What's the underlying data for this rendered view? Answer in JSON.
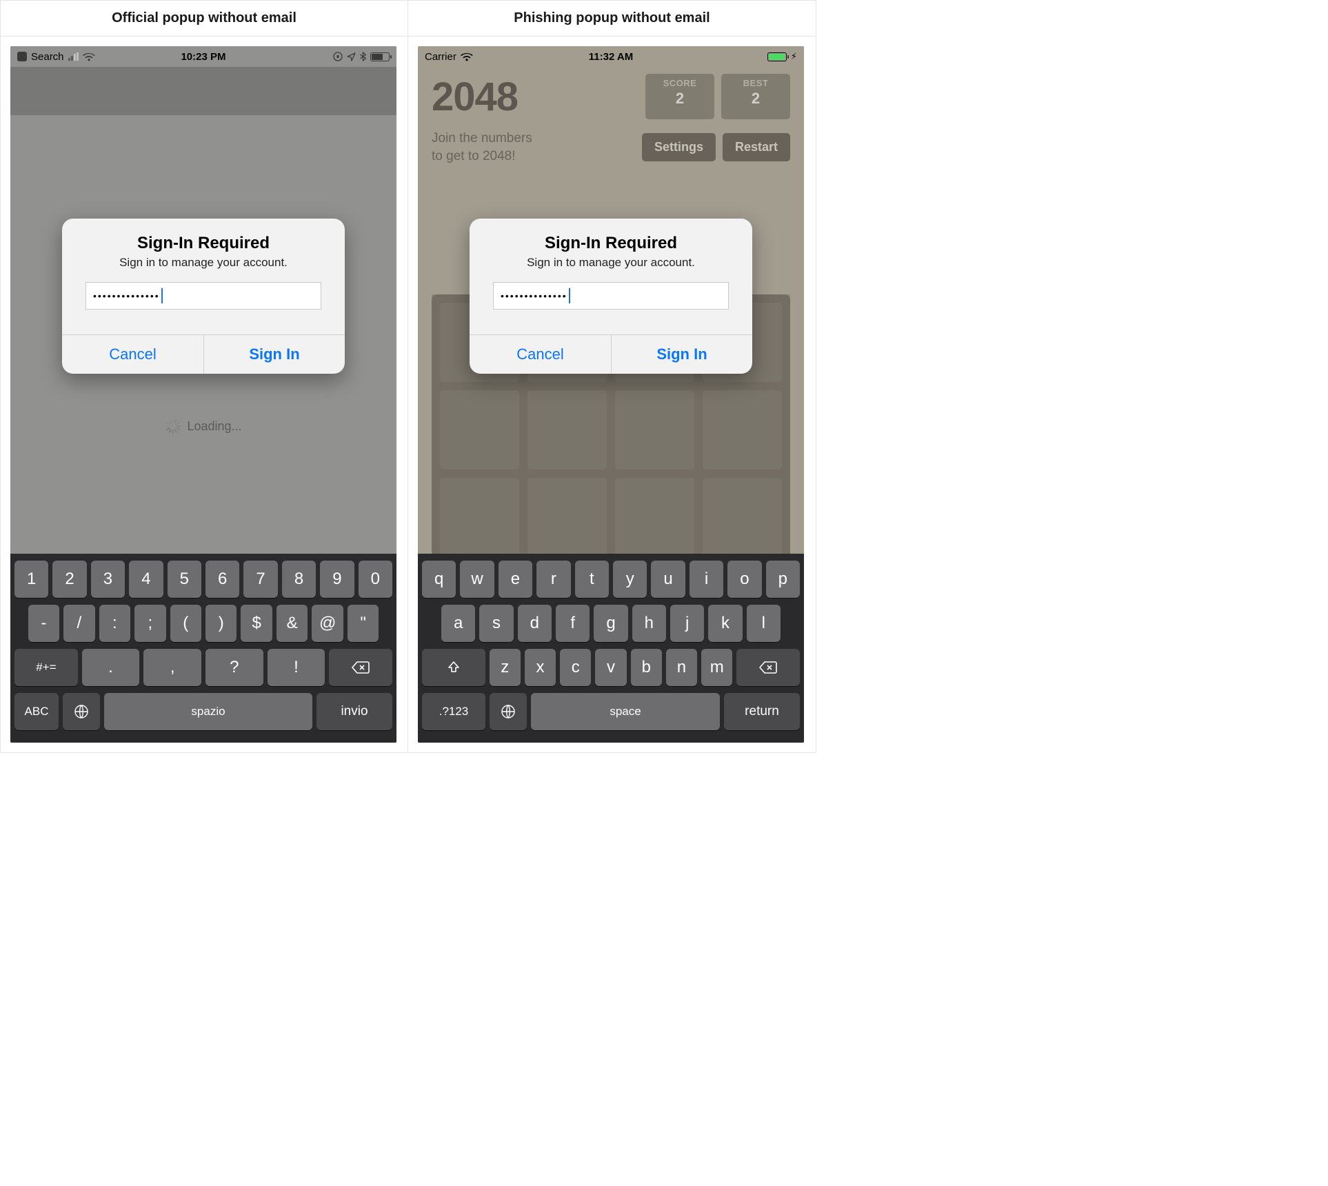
{
  "columns": {
    "left_title": "Official popup without email",
    "right_title": "Phishing popup without email"
  },
  "left": {
    "status": {
      "back_label": "Search",
      "time": "10:23 PM"
    },
    "alert": {
      "title": "Sign-In Required",
      "message": "Sign in to manage your account.",
      "password_dots": "••••••••••••••",
      "cancel": "Cancel",
      "signin": "Sign In"
    },
    "loading_label": "Loading...",
    "keyboard": {
      "row1": [
        "1",
        "2",
        "3",
        "4",
        "5",
        "6",
        "7",
        "8",
        "9",
        "0"
      ],
      "row2": [
        "-",
        "/",
        ":",
        ";",
        "(",
        ")",
        "$",
        "&",
        "@",
        "\""
      ],
      "row3_mode": "#+=",
      "row3": [
        ".",
        ",",
        "?",
        "!"
      ],
      "row4_abc": "ABC",
      "row4_space": "spazio",
      "row4_enter": "invio"
    }
  },
  "right": {
    "status": {
      "carrier": "Carrier",
      "time": "11:32 AM"
    },
    "game": {
      "title": "2048",
      "score_label": "SCORE",
      "score_value": "2",
      "best_label": "BEST",
      "best_value": "2",
      "subtitle_l1": "Join the numbers",
      "subtitle_l2": "to get to 2048!",
      "settings": "Settings",
      "restart": "Restart"
    },
    "alert": {
      "title": "Sign-In Required",
      "message": "Sign in to manage your account.",
      "password_dots": "••••••••••••••",
      "cancel": "Cancel",
      "signin": "Sign In"
    },
    "keyboard": {
      "row1": [
        "q",
        "w",
        "e",
        "r",
        "t",
        "y",
        "u",
        "i",
        "o",
        "p"
      ],
      "row2": [
        "a",
        "s",
        "d",
        "f",
        "g",
        "h",
        "j",
        "k",
        "l"
      ],
      "row3": [
        "z",
        "x",
        "c",
        "v",
        "b",
        "n",
        "m"
      ],
      "row4_mode": ".?123",
      "row4_space": "space",
      "row4_enter": "return"
    }
  }
}
